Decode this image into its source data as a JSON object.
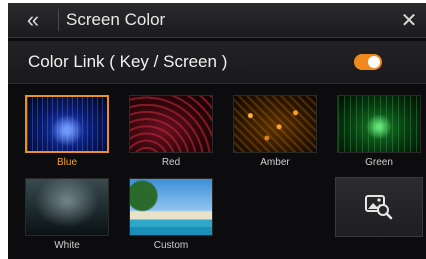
{
  "header": {
    "back_icon": "double-chevron-left-icon",
    "back_glyph": "«",
    "title": "Screen Color",
    "close_icon": "close-icon",
    "close_glyph": "✕"
  },
  "color_link": {
    "label": "Color Link ( Key / Screen )",
    "enabled": true,
    "accent_color": "#f08a1f"
  },
  "colors": [
    {
      "id": "blue",
      "label": "Blue",
      "selected": true
    },
    {
      "id": "red",
      "label": "Red",
      "selected": false
    },
    {
      "id": "amber",
      "label": "Amber",
      "selected": false
    },
    {
      "id": "green",
      "label": "Green",
      "selected": false
    },
    {
      "id": "white",
      "label": "White",
      "selected": false
    },
    {
      "id": "custom",
      "label": "Custom",
      "selected": false
    }
  ],
  "image_search_button": {
    "icon": "image-search-icon"
  }
}
